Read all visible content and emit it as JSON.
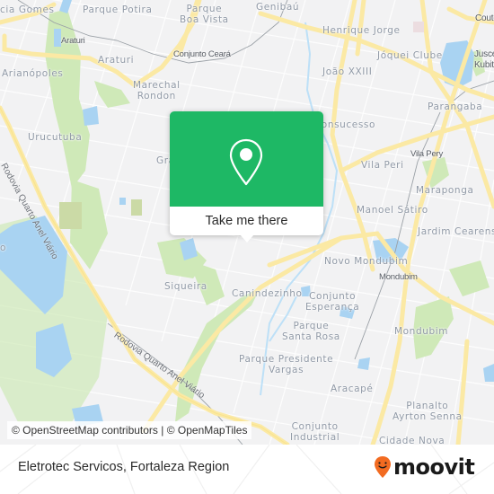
{
  "map": {
    "neighborhoods": [
      {
        "id": "arianopoles-gomes",
        "label": "cia Gomes"
      },
      {
        "id": "parque-potira",
        "label": "Parque Potira"
      },
      {
        "id": "parque-boa-vista",
        "label": "Parque\nBoa Vista"
      },
      {
        "id": "genibau",
        "label": "Genibaú"
      },
      {
        "id": "henrique-jorge",
        "label": "Henrique Jorge"
      },
      {
        "id": "araturi",
        "label": "Araturi"
      },
      {
        "id": "jockey-clube",
        "label": "Jóquei Clube"
      },
      {
        "id": "arianopoles",
        "label": "Arianópoles"
      },
      {
        "id": "joao-xxiii",
        "label": "João XXIII"
      },
      {
        "id": "marechal-rondon",
        "label": "Marechal\nRondon"
      },
      {
        "id": "parangaba",
        "label": "Parangaba"
      },
      {
        "id": "urucutuba",
        "label": "Urucutuba"
      },
      {
        "id": "bonsucesso",
        "label": "Bonsucesso"
      },
      {
        "id": "vila-peri",
        "label": "Vila Peri"
      },
      {
        "id": "granja",
        "label": "Gra"
      },
      {
        "id": "maraponga",
        "label": "Maraponga"
      },
      {
        "id": "manoel-satiro",
        "label": "Manoel Sátiro"
      },
      {
        "id": "jardim-cearense",
        "label": "Jardim Cearense"
      },
      {
        "id": "novo-mondubim",
        "label": "Novo Mondubim"
      },
      {
        "id": "siqueira",
        "label": "Siqueira"
      },
      {
        "id": "canindezinho",
        "label": "Canindezinho"
      },
      {
        "id": "conjunto-esperanca",
        "label": "Conjunto\nEsperança"
      },
      {
        "id": "mondubim",
        "label": "Mondubim"
      },
      {
        "id": "parque-santa-rosa",
        "label": "Parque\nSanta Rosa"
      },
      {
        "id": "parque-presidente-vargas",
        "label": "Parque Presidente\nVargas"
      },
      {
        "id": "aracape",
        "label": "Aracapé"
      },
      {
        "id": "planalto-ayrton-senna",
        "label": "Planalto\nAyrton Senna"
      },
      {
        "id": "conjunto-industrial",
        "label": "Conjunto\nIndustrial"
      },
      {
        "id": "cidade-nova",
        "label": "Cidade Nova"
      },
      {
        "id": "juscelino-kubitschek",
        "label": "Jusce\nKubits"
      },
      {
        "id": "couto",
        "label": "Couto"
      },
      {
        "id": "o-edge",
        "label": "o"
      }
    ],
    "pois": [
      {
        "id": "araturi-station",
        "label": "Araturi"
      },
      {
        "id": "conjunto-ceara",
        "label": "Conjunto Ceará"
      },
      {
        "id": "vila-pery-station",
        "label": "Vila Pery"
      },
      {
        "id": "mondubim-station",
        "label": "Mondubim"
      }
    ],
    "roads": [
      {
        "id": "anel-viario-west",
        "label": "Rodovia Quarto Anel Viário"
      },
      {
        "id": "anel-viario-south",
        "label": "Rodovia Quarto Anel Viário"
      }
    ],
    "colors": {
      "background": "#f2f2f3",
      "water": "#a9d3f2",
      "park": "#cfe9b8",
      "major_road": "#fbe9a4",
      "minor_road": "#ffffff"
    }
  },
  "popup": {
    "icon": "map-pin-icon",
    "action_label": "Take me there",
    "color": "#1eb865"
  },
  "attribution": "© OpenStreetMap contributors | © OpenMapTiles",
  "footer": {
    "title": "Eletrotec Servicos, Fortaleza Region",
    "logo_text": "moovit",
    "logo_icon": "moovit-pin-icon",
    "logo_color": "#f26b21"
  }
}
